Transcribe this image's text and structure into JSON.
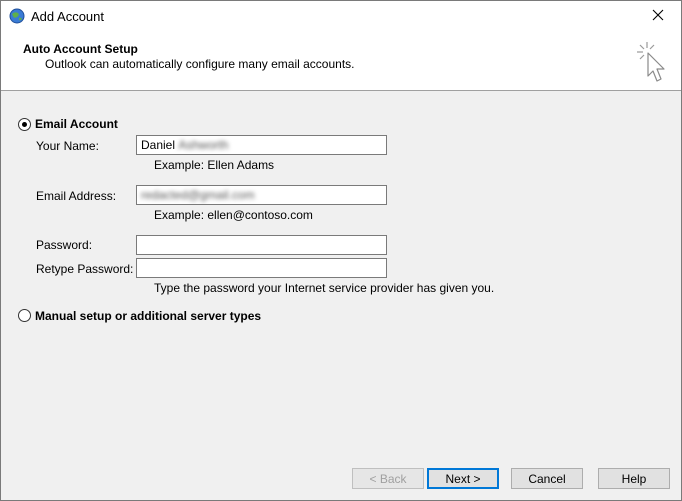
{
  "window": {
    "title": "Add Account"
  },
  "header": {
    "title": "Auto Account Setup",
    "subtitle": "Outlook can automatically configure many email accounts."
  },
  "email_account": {
    "option_label": "Email Account",
    "selected": true,
    "your_name_label": "Your Name:",
    "your_name_value_visible": "Daniel",
    "your_name_value_obscured": "Ashworth",
    "your_name_example": "Example: Ellen Adams",
    "email_label": "Email Address:",
    "email_value_obscured": "redacted@gmail.com",
    "email_example": "Example: ellen@contoso.com",
    "password_label": "Password:",
    "retype_password_label": "Retype Password:",
    "password_hint": "Type the password your Internet service provider has given you."
  },
  "manual_setup": {
    "option_label": "Manual setup or additional server types",
    "selected": false
  },
  "footer": {
    "back_label": "< Back",
    "next_label": "Next >",
    "cancel_label": "Cancel",
    "help_label": "Help"
  },
  "colors": {
    "accent": "#0078d7",
    "header_bg": "#ffffff",
    "body_bg": "#f0f0f0"
  },
  "icons": {
    "title_icon": "outlook-globe-icon",
    "close_icon": "close-icon",
    "wizard_icon": "wizard-cursor-icon"
  }
}
